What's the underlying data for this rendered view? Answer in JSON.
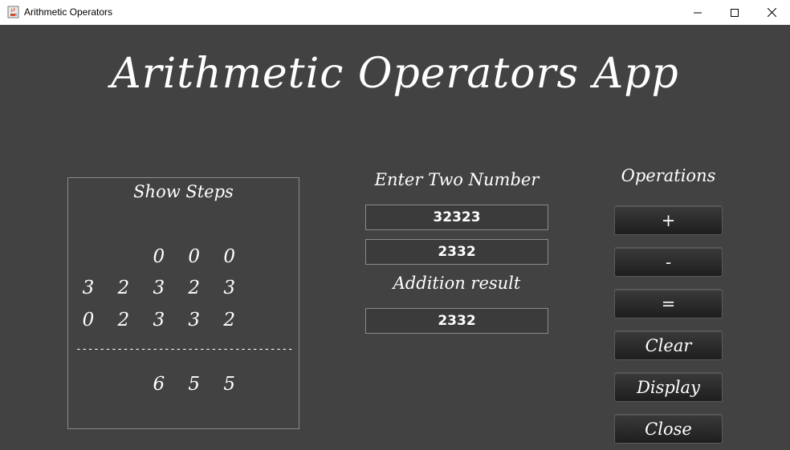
{
  "window": {
    "title": "Arithmetic Operators"
  },
  "app": {
    "title": "Arithmetic Operators App"
  },
  "steps": {
    "title": "Show Steps",
    "carry_row": "0 0 0",
    "first_row": "3 2 3 2 3",
    "second_row": "0 2 3 3 2",
    "separator": "-------------------------------------",
    "result_row": "6 5 5"
  },
  "inputs": {
    "label": "Enter Two Number",
    "first_value": "32323",
    "second_value": "2332",
    "result_label": "Addition result",
    "result_value": "2332"
  },
  "operations": {
    "label": "Operations",
    "buttons": [
      "+",
      "-",
      "=",
      "Clear",
      "Display",
      "Close"
    ]
  }
}
